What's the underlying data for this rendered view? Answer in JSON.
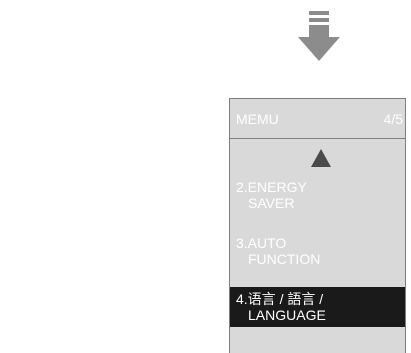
{
  "scroll_indicator": {
    "icon": "down-arrow-icon"
  },
  "menu": {
    "title": "MEMU",
    "page": "4/5",
    "scroll_up_icon": "up-triangle-icon",
    "items": [
      {
        "line1": "2.ENERGY",
        "line2": "SAVER",
        "selected": false
      },
      {
        "line1": "3.AUTO",
        "line2": "FUNCTION",
        "selected": false
      },
      {
        "line1": "4.语言 / 語言 /",
        "line2": "LANGUAGE",
        "selected": true
      }
    ]
  },
  "colors": {
    "panel_background": "#d9d9d9",
    "selected_background": "#1a1a1a",
    "text": "#ffffff",
    "arrow": "#8c8c8c"
  }
}
